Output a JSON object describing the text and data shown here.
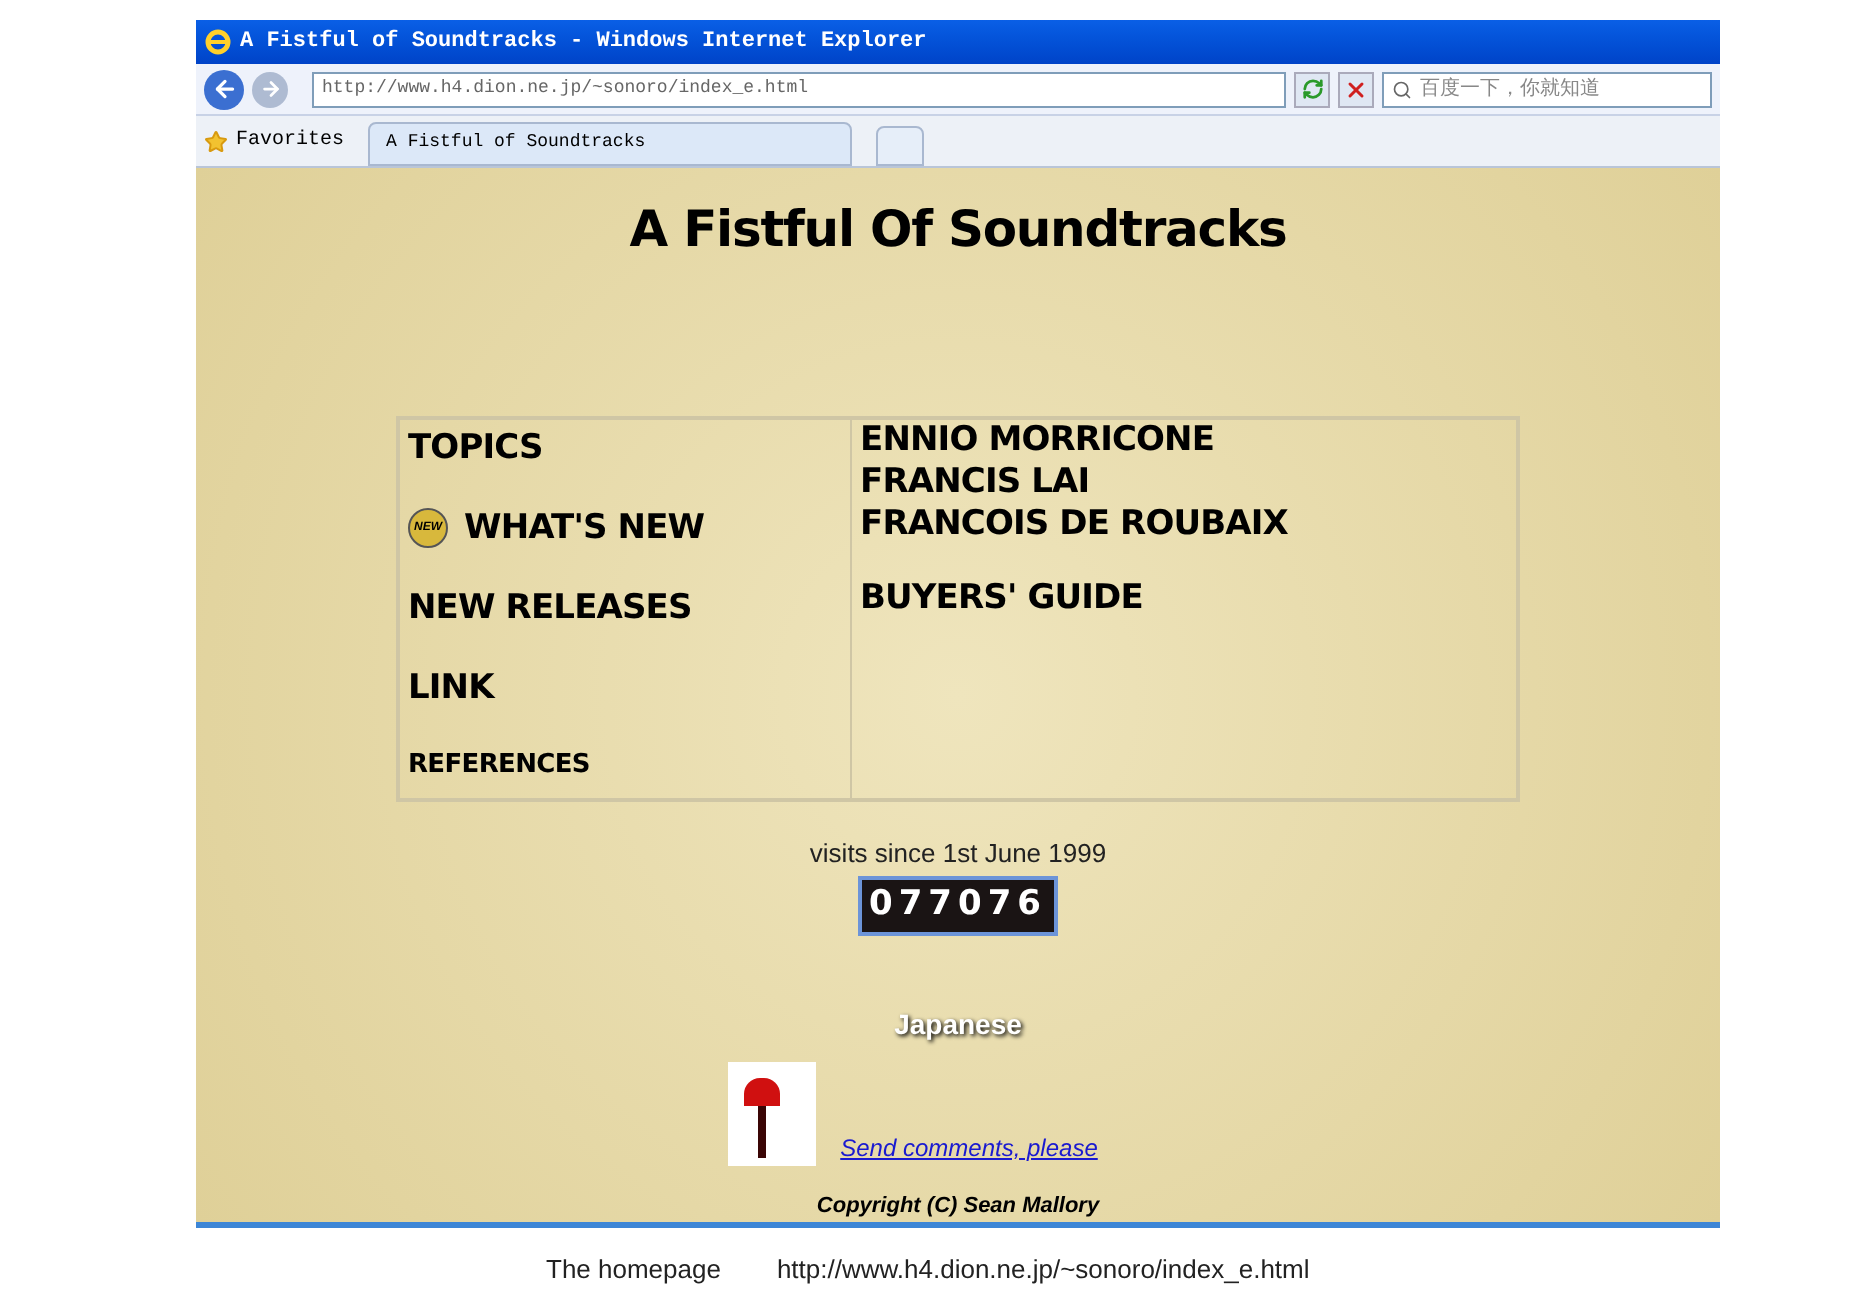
{
  "window": {
    "title": "A Fistful of Soundtracks - Windows Internet Explorer"
  },
  "address_bar": {
    "value": "http://www.h4.dion.ne.jp/~sonoro/index_e.html"
  },
  "search": {
    "placeholder": "百度一下，你就知道"
  },
  "favorites": {
    "label": "Favorites"
  },
  "tabs": [
    {
      "label": "A Fistful of Soundtracks",
      "selected": true
    }
  ],
  "page": {
    "heading": "A Fistful Of Soundtracks",
    "menu_left": [
      {
        "label": "TOPICS",
        "kind": "plain"
      },
      {
        "label": "WHAT'S NEW",
        "kind": "new",
        "badge": "NEW"
      },
      {
        "label": "NEW RELEASES",
        "kind": "plain"
      },
      {
        "label": "LINK",
        "kind": "plain"
      },
      {
        "label": "REFERENCES",
        "kind": "small"
      }
    ],
    "menu_right": [
      {
        "label": "ENNIO MORRICONE",
        "kind": "plain"
      },
      {
        "label": "FRANCIS LAI",
        "kind": "plain"
      },
      {
        "label": "FRANCOIS DE ROUBAIX",
        "kind": "plain"
      },
      {
        "label": "BUYERS' GUIDE",
        "kind": "spaced"
      }
    ],
    "visits": "visits since 1st June 1999",
    "counter": "077076",
    "language_link": "Japanese",
    "comments_link": "Send comments, please",
    "copyright": "Copyright (C) Sean Mallory"
  },
  "caption": {
    "label": "The homepage",
    "url": "http://www.h4.dion.ne.jp/~sonoro/index_e.html"
  }
}
